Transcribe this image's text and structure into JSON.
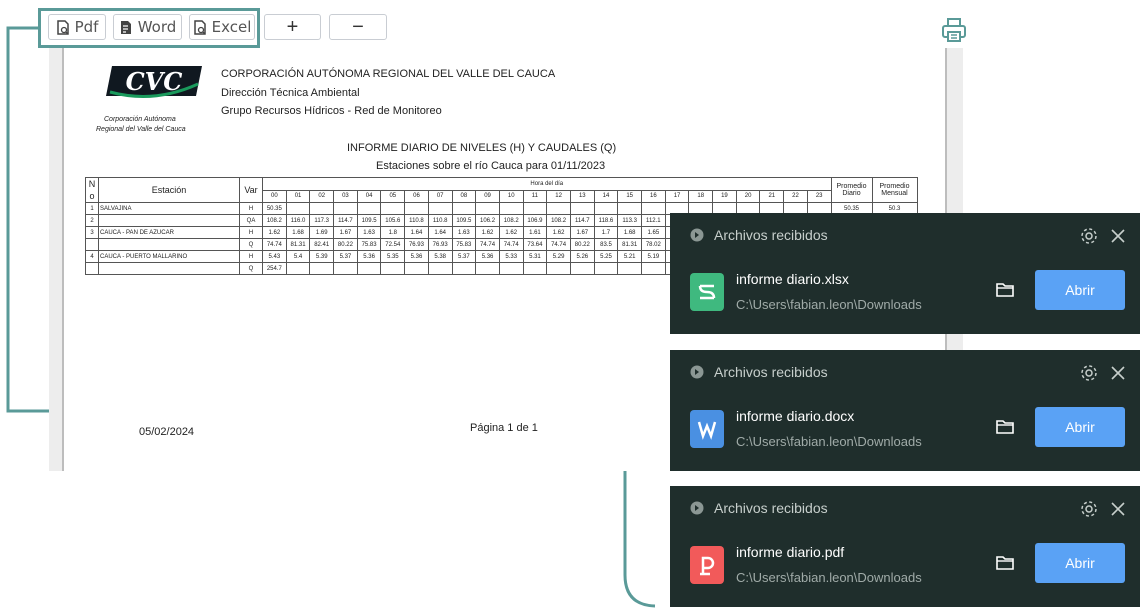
{
  "toolbar": {
    "pdf_label": "Pdf",
    "word_label": "Word",
    "excel_label": "Excel",
    "zoom_in_label": "+",
    "zoom_out_label": "−",
    "highlight_color": "#5a9a98"
  },
  "document": {
    "logo_text": "CVC",
    "logo_caption_1": "Corporación Autónoma",
    "logo_caption_2": "Regional del Valle del Cauca",
    "org_name": "CORPORACIÓN AUTÓNOMA  REGIONAL DEL VALLE DEL CAUCA",
    "org_dept": "Dirección Técnica Ambiental",
    "org_group": "Grupo Recursos Hídricos - Red de Monitoreo",
    "report_title": "INFORME DIARIO DE NIVELES (H) Y CAUDALES (Q)",
    "report_subtitle": "Estaciones sobre el río Cauca para 01/11/2023",
    "footer_date": "05/02/2024",
    "footer_page": "Página 1 de 1",
    "table": {
      "col_no": "N o",
      "col_station": "Estación",
      "col_var": "Var",
      "col_hour": "Hora del día",
      "col_avg_daily": "Promedio Diario",
      "col_avg_monthly": "Promedio Mensual",
      "hours": [
        "00",
        "01",
        "02",
        "03",
        "04",
        "05",
        "06",
        "07",
        "08",
        "09",
        "10",
        "11",
        "12",
        "13",
        "14",
        "15",
        "16",
        "17",
        "18",
        "19",
        "20",
        "21",
        "22",
        "23"
      ],
      "rows": [
        {
          "no": "1",
          "station": "SALVAJINA",
          "var": "H",
          "vals": [
            "50.35",
            "",
            "",
            "",
            "",
            "",
            "",
            "",
            "",
            "",
            "",
            "",
            "",
            "",
            "",
            "",
            "",
            "",
            "",
            "",
            "",
            "",
            "",
            ""
          ],
          "daily": "50.35",
          "monthly": "50.3"
        },
        {
          "no": "2",
          "station": "",
          "var": "QA",
          "vals": [
            "108.2",
            "116.0",
            "117.3",
            "114.7",
            "109.5",
            "105.6",
            "110.8",
            "110.8",
            "109.5",
            "106.2",
            "108.2",
            "106.9",
            "108.2",
            "114.7",
            "118.6",
            "113.3",
            "112.1",
            "",
            "",
            "",
            "",
            "",
            "",
            ""
          ],
          "daily": "",
          "monthly": ""
        },
        {
          "no": "3",
          "station": "CAUCA - PAN DE AZUCAR",
          "var": "H",
          "vals": [
            "1.62",
            "1.68",
            "1.69",
            "1.67",
            "1.63",
            "1.8",
            "1.64",
            "1.64",
            "1.63",
            "1.62",
            "1.62",
            "1.61",
            "1.62",
            "1.67",
            "1.7",
            "1.68",
            "1.65",
            "",
            "",
            "",
            "",
            "",
            "",
            ""
          ],
          "daily": "",
          "monthly": ""
        },
        {
          "no": "",
          "station": "",
          "var": "Q",
          "vals": [
            "74.74",
            "81.31",
            "82.41",
            "80.22",
            "75.83",
            "72.54",
            "76.93",
            "76.93",
            "75.83",
            "74.74",
            "74.74",
            "73.64",
            "74.74",
            "80.22",
            "83.5",
            "81.31",
            "78.02",
            "",
            "",
            "",
            "",
            "",
            "",
            ""
          ],
          "daily": "",
          "monthly": ""
        },
        {
          "no": "4",
          "station": "CAUCA - PUERTO MALLARINO",
          "var": "H",
          "vals": [
            "5.43",
            "5.4",
            "5.39",
            "5.37",
            "5.36",
            "5.35",
            "5.36",
            "5.38",
            "5.37",
            "5.36",
            "5.33",
            "5.31",
            "5.29",
            "5.26",
            "5.25",
            "5.21",
            "5.19",
            "",
            "",
            "",
            "",
            "",
            "",
            ""
          ],
          "daily": "",
          "monthly": ""
        },
        {
          "no": "",
          "station": "",
          "var": "Q",
          "vals": [
            "254.7",
            "",
            "",
            "",
            "",
            "",
            "",
            "",
            "",
            "",
            "",
            "",
            "",
            "",
            "",
            "",
            "",
            "",
            "",
            "",
            "",
            "",
            "",
            ""
          ],
          "daily": "",
          "monthly": ""
        }
      ]
    }
  },
  "notifications": [
    {
      "header": "Archivos recibidos",
      "file_name": "informe diario.xlsx",
      "path": "C:\\Users\\fabian.leon\\Downloads",
      "open_label": "Abrir",
      "icon": "excel-file-icon",
      "icon_color": "#3fb97f"
    },
    {
      "header": "Archivos recibidos",
      "file_name": "informe diario.docx",
      "path": "C:\\Users\\fabian.leon\\Downloads",
      "open_label": "Abrir",
      "icon": "word-file-icon",
      "icon_color": "#4a90e2"
    },
    {
      "header": "Archivos recibidos",
      "file_name": "informe diario.pdf",
      "path": "C:\\Users\\fabian.leon\\Downloads",
      "open_label": "Abrir",
      "icon": "pdf-file-icon",
      "icon_color": "#f25a5a"
    }
  ]
}
